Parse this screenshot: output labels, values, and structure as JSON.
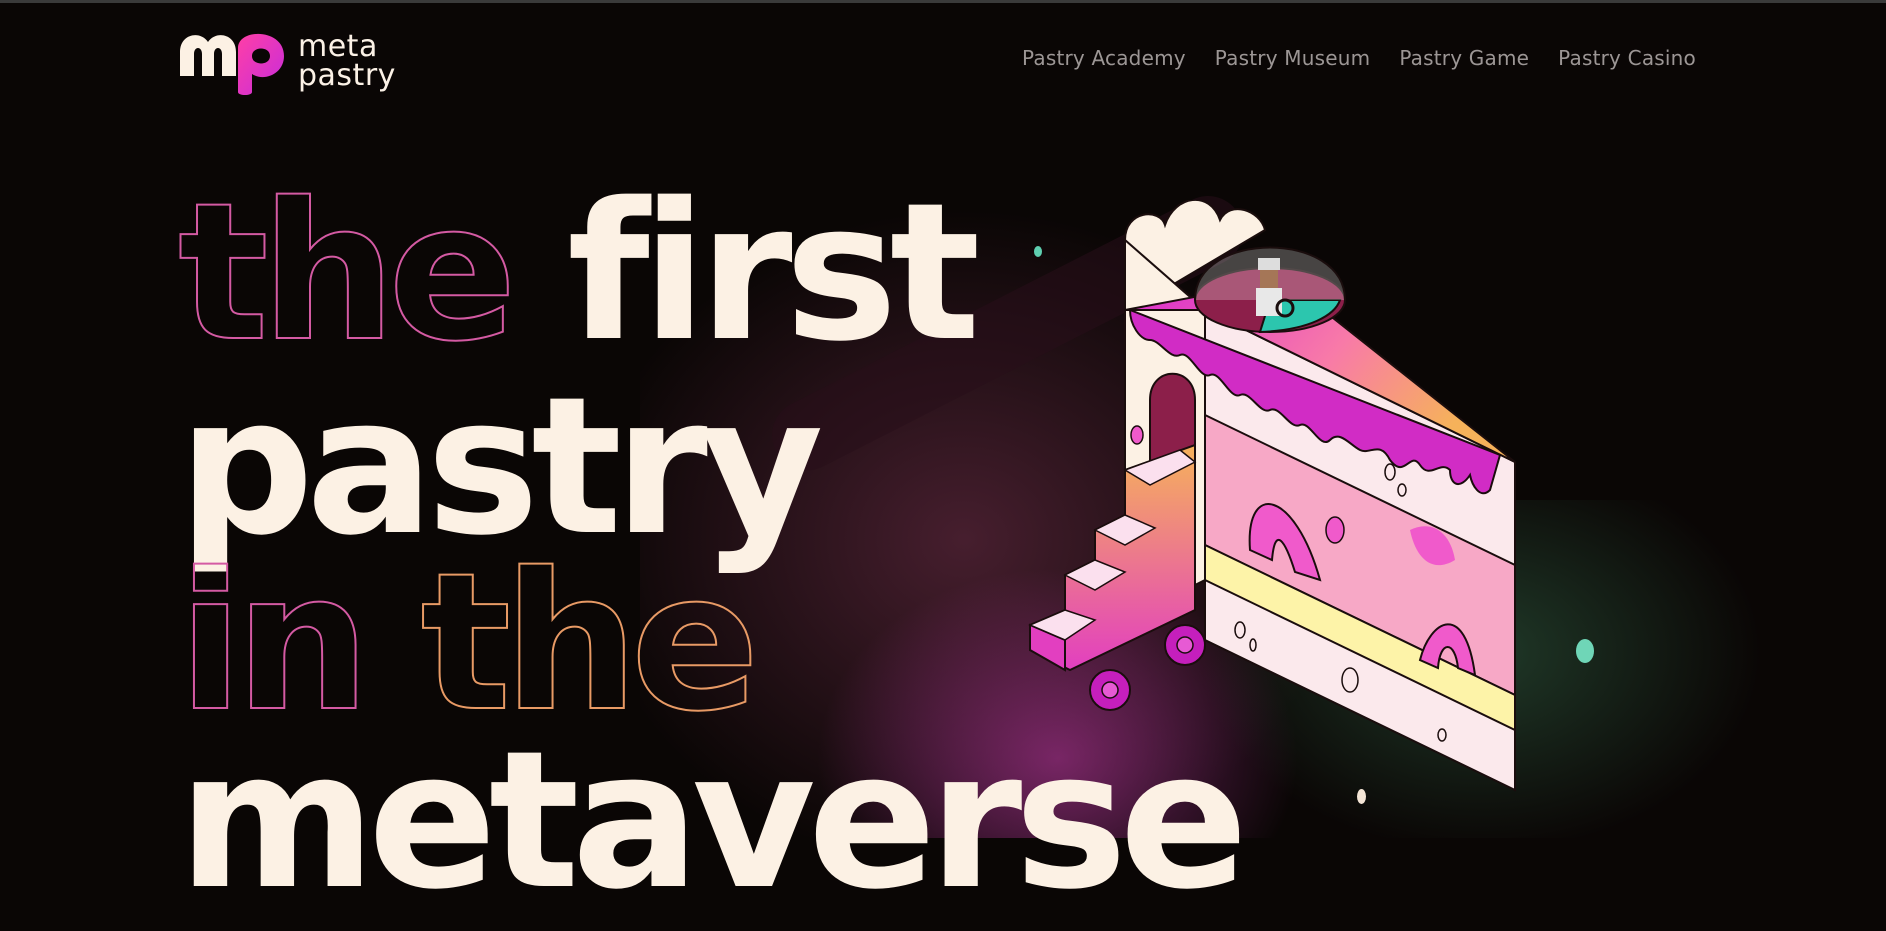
{
  "brand": {
    "logo_mark": "mp",
    "name_line1": "meta",
    "name_line2": "pastry"
  },
  "nav": {
    "items": [
      {
        "label": "Pastry Academy"
      },
      {
        "label": "Pastry Museum"
      },
      {
        "label": "Pastry Game"
      },
      {
        "label": "Pastry Casino"
      }
    ]
  },
  "hero": {
    "line1_outline": "the",
    "line1_solid": "first",
    "line2_solid": "pastry",
    "line3_outline_a": "in",
    "line3_outline_b": "the",
    "line4_solid": "metaverse"
  },
  "illustration": {
    "name": "pastry-cake-vehicle-illustration"
  },
  "colors": {
    "background": "#0a0605",
    "cream": "#fcf1e4",
    "pink": "#e23fc0",
    "magenta": "#d92ad0",
    "orange": "#f6a35a",
    "teal": "#2cc6ae",
    "nav_text": "#9c9695"
  }
}
